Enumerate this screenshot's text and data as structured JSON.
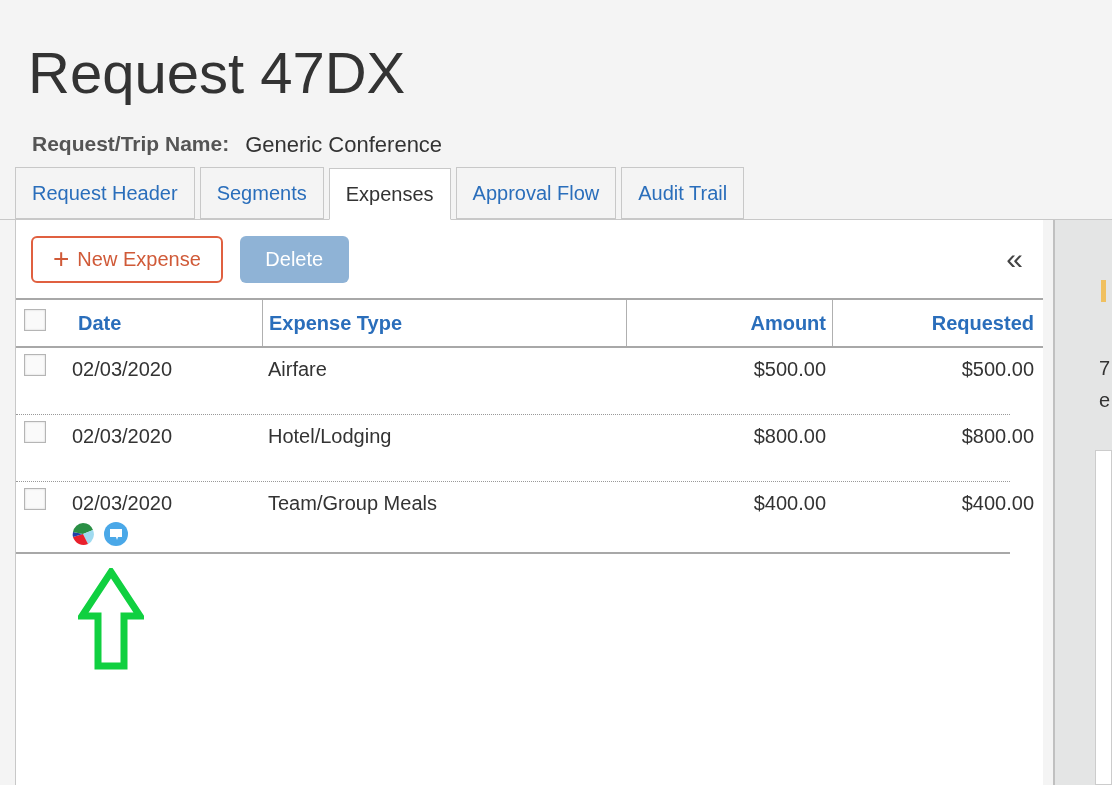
{
  "title": "Request 47DX",
  "trip": {
    "label": "Request/Trip Name:",
    "value": "Generic Conference"
  },
  "tabs": [
    {
      "label": "Request Header",
      "selected": false
    },
    {
      "label": "Segments",
      "selected": false
    },
    {
      "label": "Expenses",
      "selected": true
    },
    {
      "label": "Approval Flow",
      "selected": false
    },
    {
      "label": "Audit Trail",
      "selected": false
    }
  ],
  "toolbar": {
    "new_button": {
      "label": "New Expense",
      "icon": "+"
    },
    "delete_button": {
      "label": "Delete",
      "disabled": true
    },
    "collapse": "«"
  },
  "table": {
    "select_all_checked": false,
    "columns": [
      "Date",
      "Expense Type",
      "Amount",
      "Requested"
    ],
    "rows": [
      {
        "checked": false,
        "date": "02/03/2020",
        "type": "Airfare",
        "amount": "$500.00",
        "requested": "$500.00",
        "icons": []
      },
      {
        "checked": false,
        "date": "02/03/2020",
        "type": "Hotel/Lodging",
        "amount": "$800.00",
        "requested": "$800.00",
        "icons": []
      },
      {
        "checked": false,
        "date": "02/03/2020",
        "type": "Team/Group Meals",
        "amount": "$400.00",
        "requested": "$400.00",
        "icons": [
          {
            "kind": "allocation"
          },
          {
            "kind": "comment"
          }
        ]
      }
    ]
  },
  "side_panel": {
    "texts": [
      "7",
      "e"
    ]
  }
}
